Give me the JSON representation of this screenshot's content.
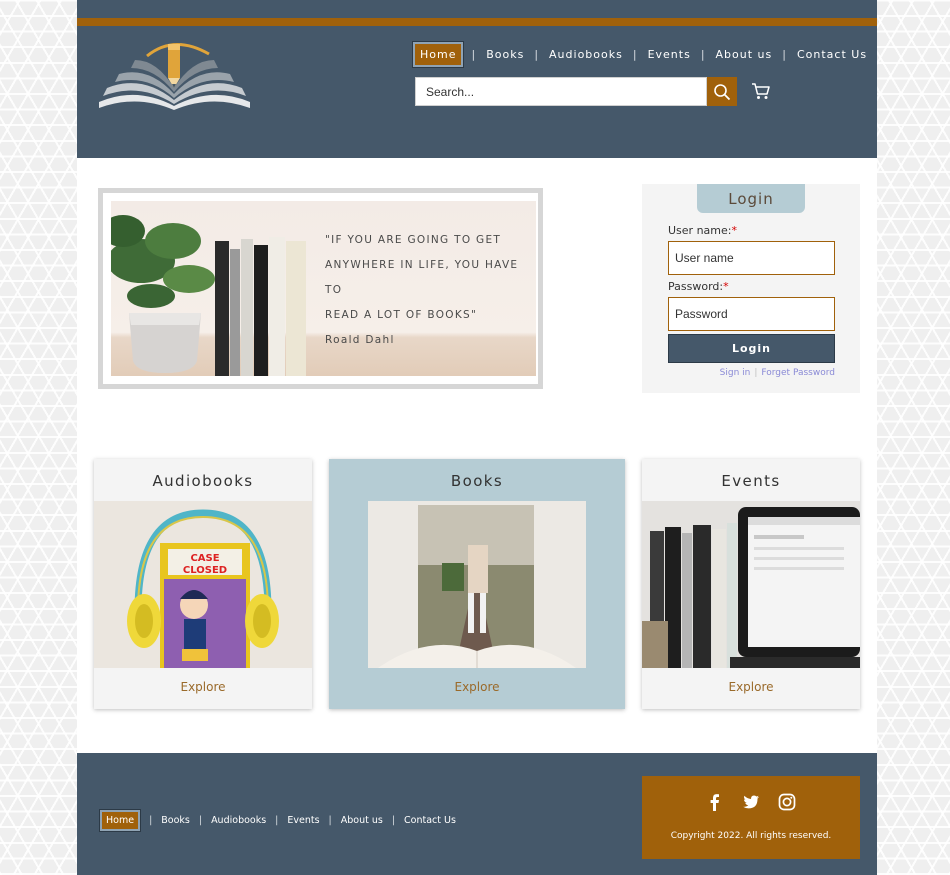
{
  "header": {
    "nav": [
      {
        "label": "Home",
        "active": true
      },
      {
        "label": "Books"
      },
      {
        "label": "Audiobooks"
      },
      {
        "label": "Events"
      },
      {
        "label": "About us"
      },
      {
        "label": "Contact Us"
      }
    ],
    "search_placeholder": "Search...",
    "icons": {
      "search": "search-icon",
      "cart": "cart-icon",
      "logo": "open-book-pencil-logo"
    }
  },
  "banner": {
    "quote_lines": [
      "\"IF YOU ARE GOING TO GET",
      "ANYWHERE IN LIFE, YOU HAVE TO",
      "READ A LOT OF BOOKS\""
    ],
    "author": "Roald Dahl"
  },
  "login": {
    "title": "Login",
    "username_label": "User name:",
    "username_placeholder": "User name",
    "password_label": "Password:",
    "password_placeholder": "Password",
    "required_mark": "*",
    "button": "Login",
    "signin_link": "Sign in",
    "forgot_link": "Forget Password"
  },
  "cards": [
    {
      "title": "Audiobooks",
      "explore": "Explore"
    },
    {
      "title": "Books",
      "explore": "Explore"
    },
    {
      "title": "Events",
      "explore": "Explore"
    }
  ],
  "footer": {
    "nav": [
      {
        "label": "Home",
        "active": true
      },
      {
        "label": "Books"
      },
      {
        "label": "Audiobooks"
      },
      {
        "label": "Events"
      },
      {
        "label": "About us"
      },
      {
        "label": "Contact Us"
      }
    ],
    "copyright": "Copyright 2022. All rights reserved.",
    "social_icons": [
      "facebook-icon",
      "twitter-icon",
      "instagram-icon"
    ]
  },
  "colors": {
    "header_bg": "#45586a",
    "accent": "#a0610b",
    "books_card_bg": "#b5ccd4"
  }
}
